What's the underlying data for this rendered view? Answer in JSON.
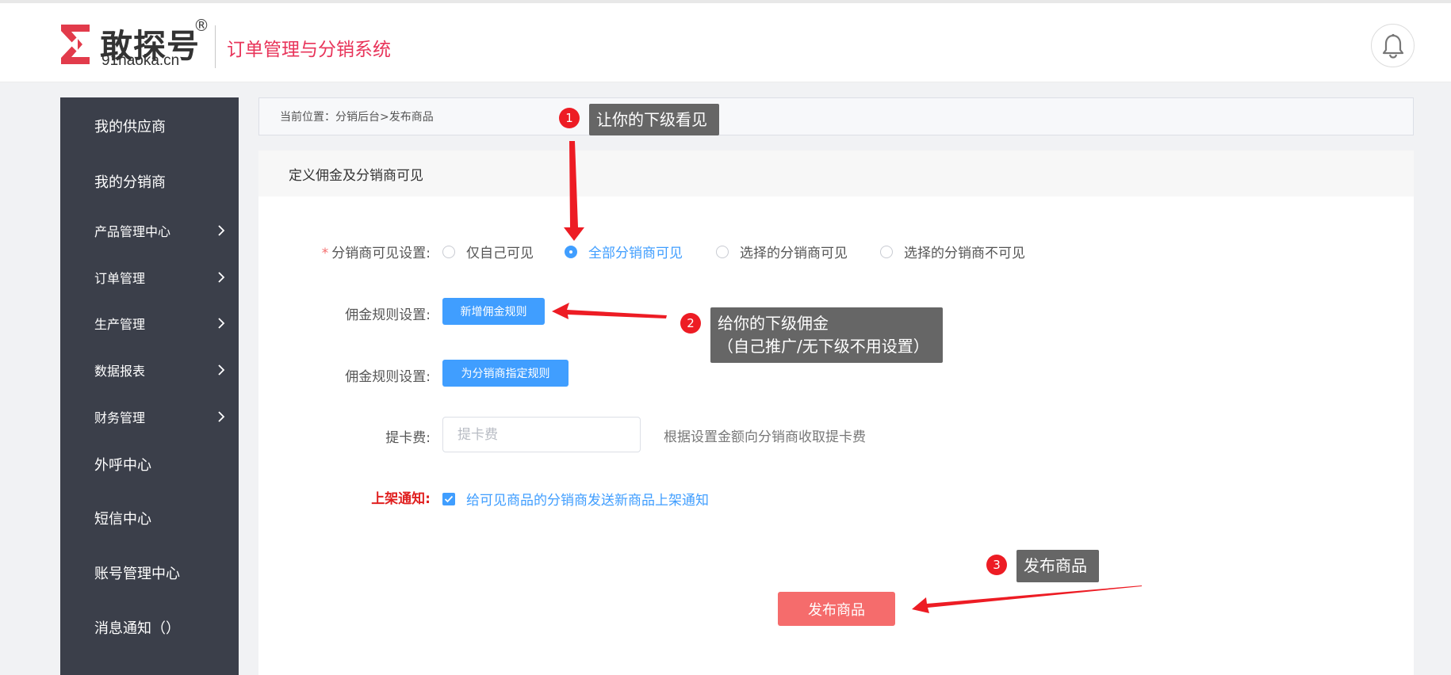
{
  "header": {
    "logo_text": "敢探号",
    "logo_registered": "®",
    "logo_domain": "91haoka.cn",
    "system_title": "订单管理与分销系统",
    "brand_color": "#e8345a"
  },
  "sidebar": {
    "items": [
      {
        "label": "我的供应商",
        "has_submenu": false
      },
      {
        "label": "我的分销商",
        "has_submenu": false
      },
      {
        "label": "产品管理中心",
        "has_submenu": true
      },
      {
        "label": "订单管理",
        "has_submenu": true
      },
      {
        "label": "生产管理",
        "has_submenu": true
      },
      {
        "label": "数据报表",
        "has_submenu": true
      },
      {
        "label": "财务管理",
        "has_submenu": true
      },
      {
        "label": "外呼中心",
        "has_submenu": false
      },
      {
        "label": "短信中心",
        "has_submenu": false
      },
      {
        "label": "账号管理中心",
        "has_submenu": false
      },
      {
        "label": "消息通知（）",
        "has_submenu": false
      }
    ]
  },
  "breadcrumb": "当前位置：分销后台>发布商品",
  "panel": {
    "title": "定义佣金及分销商可见",
    "visibility": {
      "required_mark": "*",
      "label": "分销商可见设置:",
      "options": [
        {
          "label": "仅自己可见",
          "checked": false
        },
        {
          "label": "全部分销商可见",
          "checked": true
        },
        {
          "label": "选择的分销商可见",
          "checked": false
        },
        {
          "label": "选择的分销商不可见",
          "checked": false
        }
      ]
    },
    "commission_rule_1": {
      "label": "佣金规则设置:",
      "button": "新增佣金规则"
    },
    "commission_rule_2": {
      "label": "佣金规则设置:",
      "button": "为分销商指定规则"
    },
    "card_fee": {
      "label": "提卡费:",
      "placeholder": "提卡费",
      "value": "",
      "hint": "根据设置金额向分销商收取提卡费"
    },
    "listing_notice": {
      "label": "上架通知:",
      "checkbox_label": "给可见商品的分销商发送新商品上架通知",
      "checked": true
    },
    "publish_button": "发布商品"
  },
  "callouts": [
    {
      "number": "1",
      "text_lines": [
        "让你的下级看见"
      ]
    },
    {
      "number": "2",
      "text_lines": [
        "给你的下级佣金",
        "（自己推广/无下级不用设置）"
      ]
    },
    {
      "number": "3",
      "text_lines": [
        "发布商品"
      ]
    }
  ],
  "colors": {
    "sidebar_bg": "#3b3f4a",
    "primary": "#409eff",
    "danger": "#f56c6c",
    "callout_bg": "#666666",
    "badge_red": "#ed1c24"
  }
}
